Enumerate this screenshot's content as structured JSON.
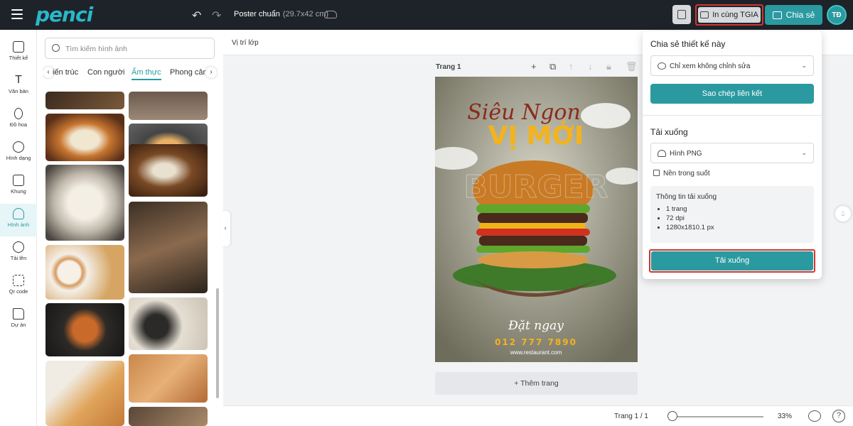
{
  "topbar": {
    "logo": "penci",
    "doc_title": "Poster chuẩn",
    "doc_size": "(29.7x42 cm)",
    "print_label": "In cùng TGIA",
    "share_label": "Chia sẻ",
    "avatar_initials": "TĐ"
  },
  "leftnav": {
    "items": [
      {
        "label": "Thiết kế",
        "icon": "layout-icon"
      },
      {
        "label": "Văn bản",
        "icon": "text-icon"
      },
      {
        "label": "Đồ hoạ",
        "icon": "brush-icon"
      },
      {
        "label": "Hình dạng",
        "icon": "shapes-icon"
      },
      {
        "label": "Khung",
        "icon": "frame-icon"
      },
      {
        "label": "Hình ảnh",
        "icon": "image-icon"
      },
      {
        "label": "Tải lên",
        "icon": "upload-icon"
      },
      {
        "label": "Qr code",
        "icon": "qr-icon"
      },
      {
        "label": "Dự án",
        "icon": "folder-icon"
      }
    ],
    "active": "Hình ảnh"
  },
  "panel": {
    "search_placeholder": "Tìm kiếm hình ảnh",
    "tabs": [
      "iến trúc",
      "Con người",
      "Ẩm thực",
      "Phong cảnh"
    ],
    "active_tab": "Ẩm thực"
  },
  "canvas": {
    "layer_position": "Vị trí lớp",
    "page_label": "Trang 1",
    "add_page": "+ Thêm trang",
    "poster": {
      "script_title": "Siêu Ngon",
      "main_title": "VỊ MỚI",
      "order_script": "Đặt ngay",
      "phone": "012 777 7890",
      "website": "www.restaurant.com",
      "bg_word": "BURGER"
    }
  },
  "footer": {
    "page_count": "Trang 1 / 1",
    "zoom": "33%",
    "zoom_fraction": 0.04
  },
  "share_popup": {
    "share_heading": "Chia sẻ thiết kế này",
    "permission": "Chỉ xem không chỉnh sửa",
    "copy_link": "Sao chép liên kết",
    "download_heading": "Tải xuống",
    "file_type": "Hình PNG",
    "transparent_bg": "Nền trong suốt",
    "info_title": "Thông tin tải xuống",
    "info_items": [
      "1 trang",
      "72 dpi",
      "1280x1810.1 px"
    ],
    "download_button": "Tải xuống"
  },
  "colors": {
    "accent": "#2a9aa0",
    "topbar": "#1e2329",
    "highlight": "#d0352f",
    "poster_yellow": "#f4b31c"
  }
}
